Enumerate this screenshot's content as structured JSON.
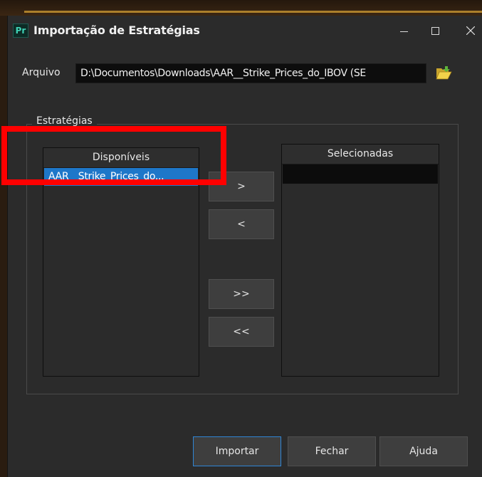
{
  "window": {
    "app_icon_text": "Pr",
    "title": "Importação de Estratégias"
  },
  "file": {
    "label": "Arquivo",
    "value": "D:\\Documentos\\Downloads\\AAR__Strike_Prices_do_IBOV (SE"
  },
  "strategies": {
    "group_label": "Estratégias",
    "available": {
      "header": "Disponíveis",
      "items": [
        "AAR__Strike_Prices_do..."
      ]
    },
    "selected": {
      "header": "Selecionadas",
      "items": []
    }
  },
  "move_buttons": {
    "add": ">",
    "remove": "<",
    "add_all": ">>",
    "remove_all": "<<"
  },
  "actions": {
    "import": "Importar",
    "close": "Fechar",
    "help": "Ajuda"
  },
  "colors": {
    "selection": "#1e77c9",
    "highlight_box": "#ff0000",
    "window_bg": "#2b2b2b"
  }
}
